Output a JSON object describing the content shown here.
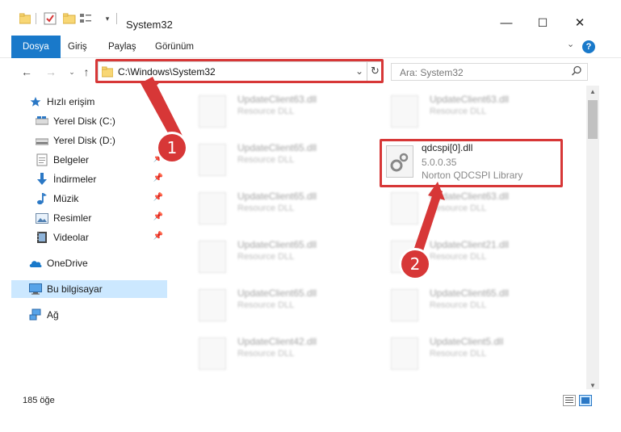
{
  "window": {
    "title": "System32",
    "minimize": "—",
    "maximize": "☐",
    "close": "✕"
  },
  "ribbon": {
    "tabs": [
      "Dosya",
      "Giriş",
      "Paylaş",
      "Görünüm"
    ],
    "expand": "⌄"
  },
  "address": {
    "path": "C:\\Windows\\System32",
    "search_placeholder": "Ara: System32"
  },
  "sidebar": {
    "items": [
      {
        "label": "Hızlı erişim",
        "icon": "star-icon"
      },
      {
        "label": "Yerel Disk (C:)",
        "icon": "drive-icon"
      },
      {
        "label": "Yerel Disk (D:)",
        "icon": "drive-icon"
      },
      {
        "label": "Belgeler",
        "icon": "documents-icon"
      },
      {
        "label": "İndirmeler",
        "icon": "download-icon"
      },
      {
        "label": "Müzik",
        "icon": "music-icon"
      },
      {
        "label": "Resimler",
        "icon": "pictures-icon"
      },
      {
        "label": "Videolar",
        "icon": "video-icon"
      },
      {
        "label": "OneDrive",
        "icon": "cloud-icon"
      },
      {
        "label": "Bu bilgisayar",
        "icon": "computer-icon"
      },
      {
        "label": "Ağ",
        "icon": "network-icon"
      }
    ]
  },
  "files": {
    "left": [
      {
        "name": "UpdateClient63.dll",
        "desc": "Resource DLL"
      },
      {
        "name": "UpdateClient65.dll",
        "desc": "Resource DLL"
      },
      {
        "name": "UpdateClient65.dll",
        "desc": "Resource DLL"
      },
      {
        "name": "UpdateClient65.dll",
        "desc": "Resource DLL"
      },
      {
        "name": "UpdateClient65.dll",
        "desc": "Resource DLL"
      },
      {
        "name": "UpdateClient42.dll",
        "desc": "Resource DLL"
      }
    ],
    "right": [
      {
        "name": "UpdateClient63.dll",
        "desc": "Resource DLL"
      },
      {
        "name": "UpdateClient63.dll",
        "desc": "Resource DLL"
      },
      {
        "name": "UpdateClient21.dll",
        "desc": "Resource DLL"
      },
      {
        "name": "UpdateClient65.dll",
        "desc": "Resource DLL"
      },
      {
        "name": "UpdateClient5.dll",
        "desc": "Resource DLL"
      }
    ],
    "target": {
      "name": "qdcspi[0].dll",
      "version": "5.0.0.35",
      "desc": "Norton QDCSPI  Library"
    }
  },
  "status": {
    "count": "185 öğe"
  },
  "steps": [
    "1",
    "2"
  ],
  "colors": {
    "accent": "#1979ca",
    "highlight": "#d73737",
    "selected": "#cce8ff"
  }
}
